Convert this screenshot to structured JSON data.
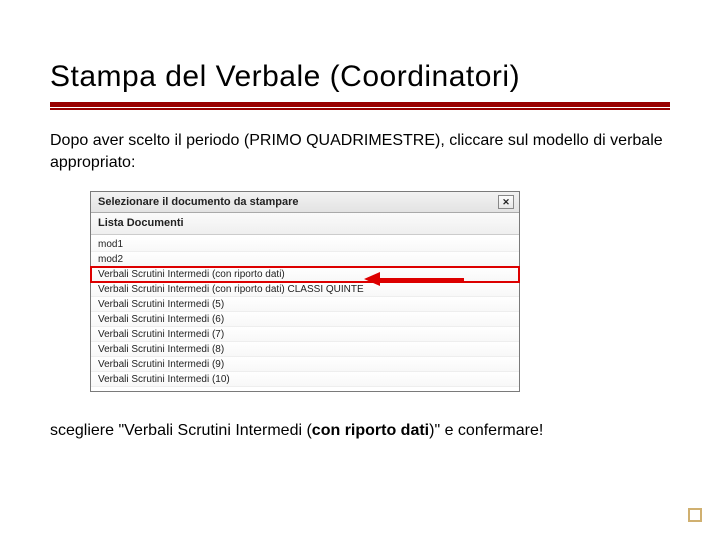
{
  "title": "Stampa del Verbale (Coordinatori)",
  "intro": "Dopo aver scelto il periodo (PRIMO QUADRIMESTRE), cliccare sul modello di verbale appropriato:",
  "dialog": {
    "caption": "Selezionare il documento da stampare",
    "subhead": "Lista Documenti",
    "close_glyph": "✕",
    "items": [
      "mod1",
      "mod2",
      "Verbali Scrutini Intermedi (con riporto dati)",
      "Verbali Scrutini Intermedi (con riporto dati) CLASSI QUINTE",
      "Verbali Scrutini Intermedi (5)",
      "Verbali Scrutini Intermedi (6)",
      "Verbali Scrutini Intermedi (7)",
      "Verbali Scrutini Intermedi (8)",
      "Verbali Scrutini Intermedi (9)",
      "Verbali Scrutini Intermedi (10)"
    ],
    "highlight_index": 2
  },
  "outro_prefix": "scegliere \"Verbali Scrutini Intermedi (",
  "outro_bold": "con riporto dati",
  "outro_suffix": ")\" e confermare!"
}
